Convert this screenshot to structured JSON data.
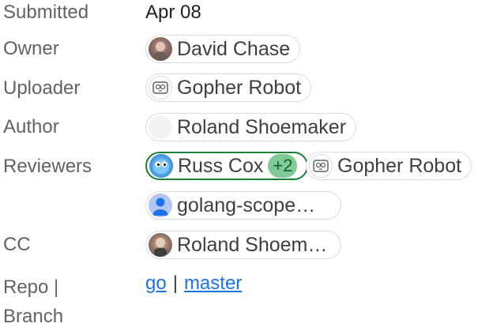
{
  "submitted": {
    "label": "Submitted",
    "value": "Apr 08"
  },
  "owner": {
    "label": "Owner",
    "name": "David Chase",
    "avatar_icon": "user-photo-icon"
  },
  "uploader": {
    "label": "Uploader",
    "name": "Gopher Robot",
    "avatar_icon": "robot-icon"
  },
  "author": {
    "label": "Author",
    "name": "Roland Shoemaker",
    "avatar_icon": "blank-avatar-icon"
  },
  "reviewers": {
    "label": "Reviewers",
    "items": [
      {
        "name": "Russ Cox",
        "badge": "+2",
        "avatar_icon": "gopher-avatar-icon",
        "attention": true
      },
      {
        "name": "Gopher Robot",
        "avatar_icon": "robot-icon"
      },
      {
        "name": "golang-scope…",
        "avatar_icon": "person-icon"
      }
    ]
  },
  "cc": {
    "label": "CC",
    "name": "Roland Shoem…",
    "avatar_icon": "user-photo-icon"
  },
  "repo_branch": {
    "label_line1": "Repo |",
    "label_line2": "Branch",
    "repo": "go",
    "separator": "|",
    "branch": "master"
  },
  "colors": {
    "label": "#5f6368",
    "link": "#1a73e8",
    "attention_border": "#188038",
    "badge_bg": "#81c995"
  }
}
